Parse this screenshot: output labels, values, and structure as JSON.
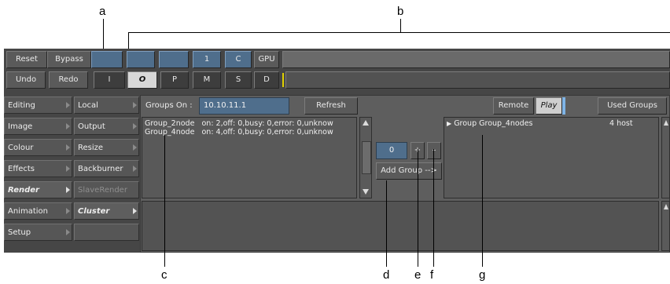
{
  "callouts": [
    "a",
    "b",
    "c",
    "d",
    "e",
    "f",
    "g"
  ],
  "toolbar": {
    "row1": {
      "reset": "Reset",
      "bypass": "Bypass",
      "one": "1",
      "c": "C",
      "gpu": "GPU"
    },
    "row2": {
      "undo": "Undo",
      "redo": "Redo",
      "i": "I",
      "o": "O",
      "p": "P",
      "m": "M",
      "s": "S",
      "d": "D"
    }
  },
  "menu_left": [
    "Editing",
    "Image",
    "Colour",
    "Effects",
    "Render",
    "Animation",
    "Setup"
  ],
  "menu_sub": [
    "Local",
    "Output",
    "Resize",
    "Backburner",
    "SlaveRender",
    "Cluster"
  ],
  "cluster": {
    "groups_on_label": "Groups On :",
    "ip": "10.10.11.1",
    "refresh": "Refresh",
    "remote_label": "Remote",
    "play": "Play",
    "used_groups": "Used Groups",
    "groups_list": [
      {
        "name": "Group_2node",
        "status": "on: 2,off: 0,busy: 0,error: 0,unknow"
      },
      {
        "name": "Group_4node",
        "status": "on: 4,off: 0,busy: 0,error: 0,unknow"
      }
    ],
    "count": "0",
    "plus": "+",
    "minus": "–",
    "add_group": "Add Group -->",
    "used_list": [
      {
        "label": "Group Group_4nodes",
        "hosts": "4 host"
      }
    ]
  },
  "colors": {
    "accent_blue": "#4f6e8c",
    "panel": "#464646",
    "highlight": "#d8d8d8"
  }
}
